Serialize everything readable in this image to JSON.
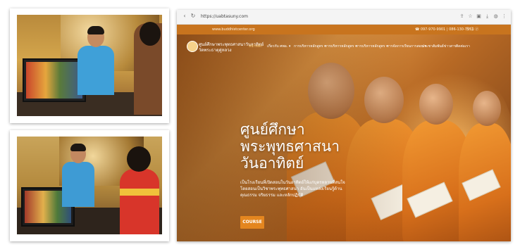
{
  "browser": {
    "url": "https://uabtasuny.com",
    "nav_back": "‹",
    "nav_reload": "↻"
  },
  "topbar": {
    "left_text": "www.buddhistcenter.org",
    "right_text": "☎ 097-970-9901 | 086-130-7951"
  },
  "site": {
    "brand_line1": "ศูนย์ศึกษาพระพุทธศาสนาวันอาทิตย์",
    "brand_line2": "วัดพระธาตุคู่หลวง",
    "nav": [
      {
        "label": "หน้าหลัก",
        "active": true
      },
      {
        "label": "เกี่ยวกับ ศพอ. ▾",
        "active": false
      },
      {
        "label": "การบริหารหลักสูตร ▾",
        "active": false
      },
      {
        "label": "การบริหารหลักสูตร ▾",
        "active": false
      },
      {
        "label": "การบริหารหลักสูตร ▾",
        "active": false
      },
      {
        "label": "การจัดการเรียนการสอน ▾",
        "active": false
      },
      {
        "label": "ประชาสัมพันธ์ข่าวสาร",
        "active": false
      },
      {
        "label": "ติดต่อเรา",
        "active": false
      }
    ],
    "hero": {
      "title_line1": "ศูนย์ศึกษา",
      "title_line2": "พระพุทธศาสนา",
      "title_line3": "วันอาทิตย์",
      "description": "เป็นโรงเรียนที่เปิดสอนในวันอาทิตย์ให้แก่บุตรหลานที่สนใจ โดยสอนเป็นวิชาพระพุทธศาสนา อันเป็นแหล่งเรียนรู้ด้านคุณธรรม จริยธรรม และหลักปฏิบัติ",
      "button": "COURSE"
    }
  },
  "icons": [
    "back-icon",
    "forward-icon",
    "reload-icon",
    "star-icon",
    "extension-icon",
    "profile-icon",
    "menu-icon"
  ]
}
